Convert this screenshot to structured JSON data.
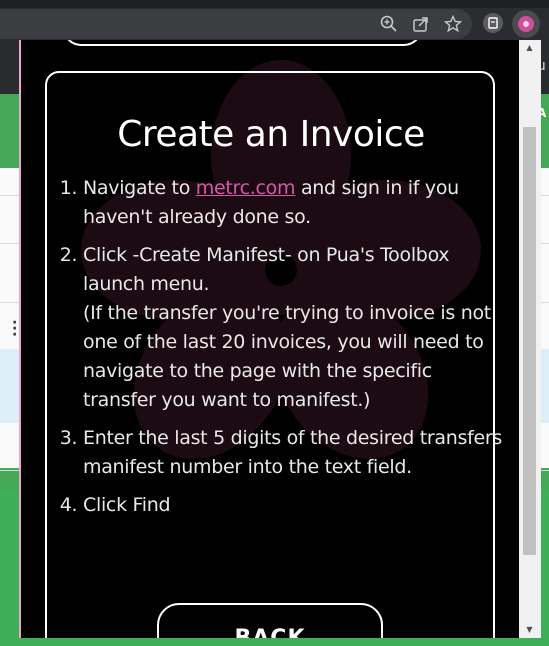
{
  "popup": {
    "title": "Create an Invoice",
    "step1_pre": "Navigate to ",
    "step1_link": "metrc.com",
    "step1_post": " and sign in if you haven't already done so.",
    "step2_main": "Click -Create Manifest- on Pua's Toolbox launch menu.",
    "step2_note": "(If the transfer you're trying to invoice is not one of the last 20 invoices, you will need to navigate to the page with the specific transfer you want to manifest.)",
    "step3": "Enter the last 5 digits of the desired transfers manifest number into the text field.",
    "step4": "Click Find",
    "back_label": "BACK"
  },
  "background": {
    "right_text_1": "lu",
    "right_text_2": "A"
  },
  "toolbar": {
    "icons": [
      "zoom-icon",
      "share-icon",
      "star-icon",
      "extension-icon",
      "flower-extension-icon"
    ]
  },
  "colors": {
    "link": "#d55aa8",
    "popup_border": "#e9a6cf",
    "page_green": "#45a858"
  }
}
